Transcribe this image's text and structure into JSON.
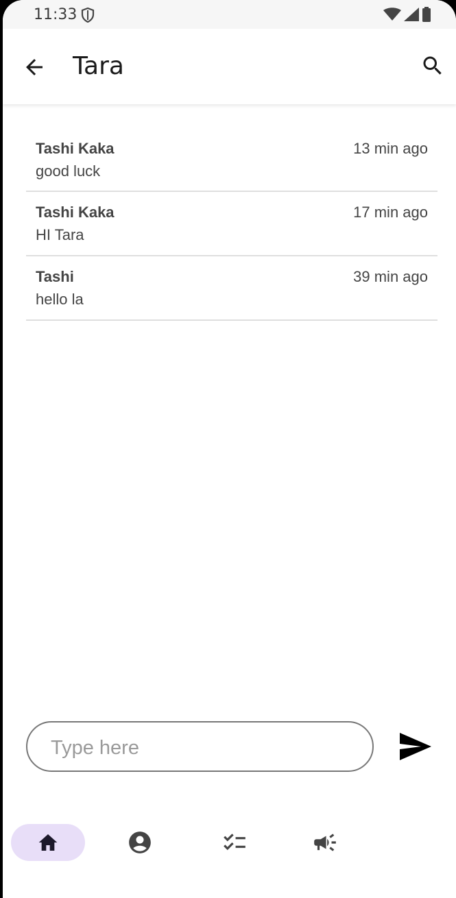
{
  "status_bar": {
    "time": "11:33"
  },
  "header": {
    "title": "Tara",
    "back_icon": "arrow-back-icon",
    "search_icon": "search-icon"
  },
  "messages": [
    {
      "sender": "Tashi Kaka",
      "time": "13 min ago",
      "text": "good luck"
    },
    {
      "sender": "Tashi Kaka",
      "time": "17 min ago",
      "text": "HI Tara"
    },
    {
      "sender": "Tashi",
      "time": "39 min ago",
      "text": "hello la"
    }
  ],
  "composer": {
    "placeholder": "Type here",
    "value": "",
    "send_icon": "send-icon"
  },
  "bottom_nav": {
    "items": [
      {
        "icon": "home-icon",
        "active": true
      },
      {
        "icon": "account-circle-icon",
        "active": false
      },
      {
        "icon": "checklist-icon",
        "active": false
      },
      {
        "icon": "campaign-icon",
        "active": false
      }
    ]
  },
  "colors": {
    "active_nav_bg": "#e8def8",
    "text": "#444444",
    "divider": "#dedede"
  }
}
